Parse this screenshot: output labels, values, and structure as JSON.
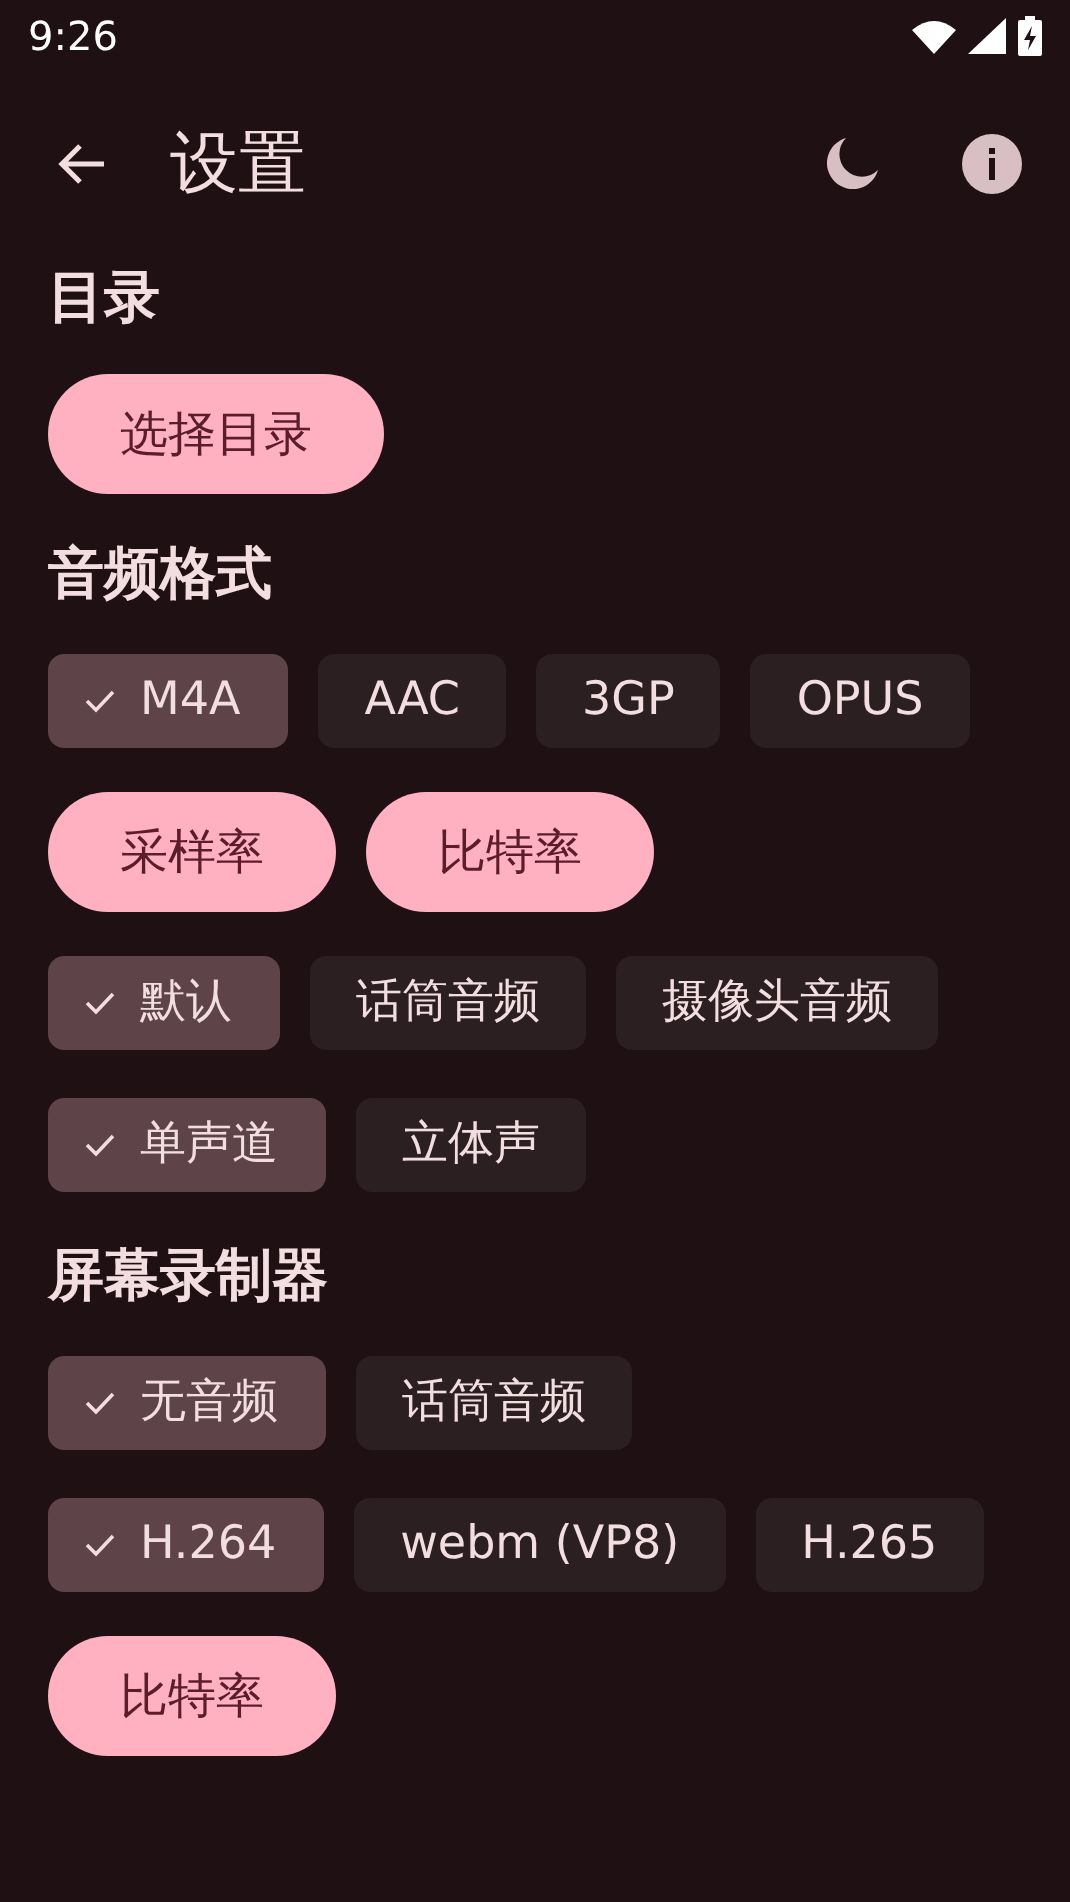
{
  "status_bar": {
    "time": "9:26"
  },
  "app_bar": {
    "title": "设置"
  },
  "sections": [
    {
      "title": "目录",
      "rows": [
        {
          "kind": "buttons",
          "items": [
            {
              "label": "选择目录"
            }
          ]
        }
      ]
    },
    {
      "title": "音频格式",
      "rows": [
        {
          "kind": "chips",
          "items": [
            {
              "label": "M4A",
              "selected": true
            },
            {
              "label": "AAC",
              "selected": false
            },
            {
              "label": "3GP",
              "selected": false
            },
            {
              "label": "OPUS",
              "selected": false
            }
          ]
        },
        {
          "kind": "buttons",
          "items": [
            {
              "label": "采样率"
            },
            {
              "label": "比特率"
            }
          ]
        },
        {
          "kind": "chips",
          "items": [
            {
              "label": "默认",
              "selected": true
            },
            {
              "label": "话筒音频",
              "selected": false
            },
            {
              "label": "摄像头音频",
              "selected": false
            }
          ]
        },
        {
          "kind": "chips",
          "items": [
            {
              "label": "单声道",
              "selected": true
            },
            {
              "label": "立体声",
              "selected": false
            }
          ]
        }
      ]
    },
    {
      "title": "屏幕录制器",
      "rows": [
        {
          "kind": "chips",
          "items": [
            {
              "label": "无音频",
              "selected": true
            },
            {
              "label": "话筒音频",
              "selected": false
            }
          ]
        },
        {
          "kind": "chips",
          "items": [
            {
              "label": "H.264",
              "selected": true
            },
            {
              "label": "webm (VP8)",
              "selected": false
            },
            {
              "label": "H.265",
              "selected": false
            }
          ]
        },
        {
          "kind": "buttons",
          "items": [
            {
              "label": "比特率"
            }
          ]
        }
      ]
    }
  ]
}
